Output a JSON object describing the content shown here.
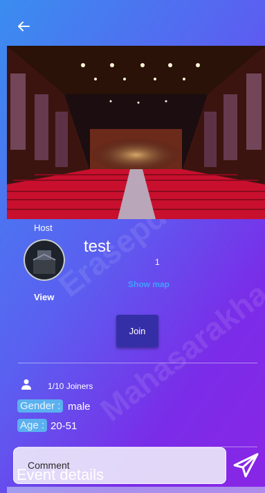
{
  "header": {
    "back_icon": "arrow-left-icon"
  },
  "banner": {
    "image_alt": "cinema hall with red seats"
  },
  "host": {
    "label": "Host",
    "view_label": "View"
  },
  "event": {
    "title": "test",
    "count": "1",
    "show_map_label": "Show map",
    "join_label": "Join"
  },
  "details": {
    "joiners": "1/10 Joiners",
    "gender_label": "Gender :",
    "gender_value": "male",
    "age_label": "Age :",
    "age_value": "20-51"
  },
  "comment": {
    "placeholder": "Comment",
    "section_title": "Event details",
    "send_icon": "send-icon"
  },
  "colors": {
    "join_button": "#352fa7",
    "show_map_link": "#3fa1ff",
    "tag_background": "#5bb1f0"
  }
}
